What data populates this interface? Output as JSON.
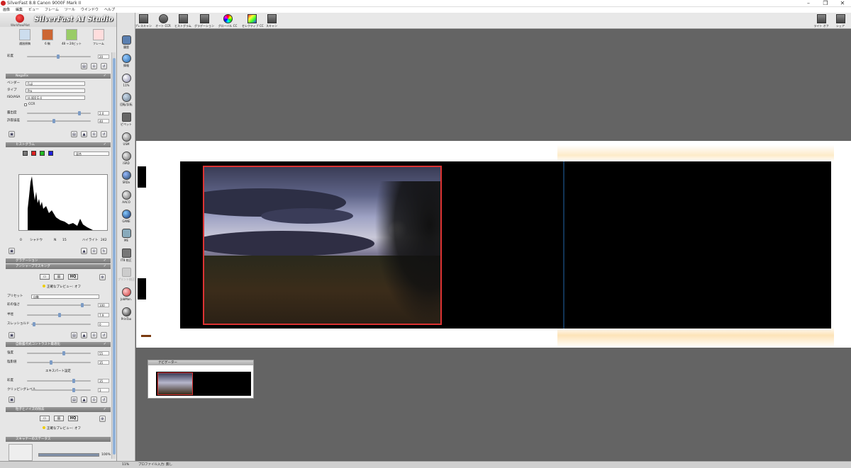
{
  "window": {
    "title": "SilverFast 8.8 Canon 9000F Mark II"
  },
  "menu": [
    "画像",
    "編集",
    "ビュー",
    "フレーム",
    "ツール",
    "ウインドウ",
    "ヘルプ"
  ],
  "logo": {
    "brand": "SilverFast AI Studio",
    "sub": "WorkflowPilot"
  },
  "modes": [
    {
      "label": "通過原稿",
      "icon": "transparency-icon"
    },
    {
      "label": "6 駒",
      "icon": "filmstrip-icon"
    },
    {
      "label": "48 → 24ビット",
      "icon": "bit-depth-icon"
    },
    {
      "label": "フレーム",
      "icon": "frame-icon"
    }
  ],
  "top_row": {
    "label": "彩度",
    "value": "20"
  },
  "negafix": {
    "title": "NegaFix",
    "vendor_label": "ベンダー",
    "vendor": "Fuji",
    "type_label": "タイプ",
    "type": "Pro",
    "iso_label": "ISO/ASA",
    "iso": "H-400 E-4",
    "ccr_label": "CCR",
    "exposure_label": "露出度",
    "exposure": "2.0",
    "tolerance_label": "許容誤差",
    "tolerance": "40"
  },
  "histogram": {
    "title": "ヒストグラム",
    "mode": "混合",
    "shadow_label": "シャドウ",
    "shadow": "0",
    "n_label": "N",
    "n": "15",
    "highlight_label": "ハイライト",
    "highlight": "242"
  },
  "gradation": {
    "title": "グラデーション"
  },
  "usm": {
    "title": "アンシャープマスキング",
    "hq": "HQ",
    "preview_warning": "正確なプレビュー: オフ",
    "preset_label": "プリセット",
    "preset": "自動",
    "strength_label": "彩の強さ",
    "strength": "100",
    "radius_label": "半径",
    "radius": "7.9",
    "threshold_label": "スレッショルド",
    "threshold": "0"
  },
  "auto_contrast": {
    "title": "自動露点式コントラスト最適化",
    "strength_label": "強度",
    "strength": "55",
    "shadow_label": "陰影値",
    "shadow": "35",
    "expert_label": "エキスパート設定",
    "saturation_label": "彩度",
    "saturation": "35",
    "clip_label": "クリッピングレベル",
    "clip": "3"
  },
  "grain": {
    "title": "粒子とノイズの除去",
    "hq": "HQ",
    "preview_warning": "正確なプレビュー: オフ"
  },
  "scanner_status": {
    "title": "スキャナーのステータス",
    "progress_pct": 100,
    "progress_text": "100%"
  },
  "tools": [
    {
      "label": "履歴",
      "icon": "undo-icon"
    },
    {
      "label": "情報",
      "icon": "info-icon"
    },
    {
      "label": "11%",
      "icon": "zoom-icon"
    },
    {
      "label": "回転/反転",
      "icon": "rotate-icon"
    },
    {
      "label": "ピペット",
      "icon": "pipette-icon"
    },
    {
      "label": "USM",
      "icon": "usm-icon"
    },
    {
      "label": "iSRD",
      "icon": "isrd-icon"
    },
    {
      "label": "SRDx",
      "icon": "srdx-icon"
    },
    {
      "label": "AACO",
      "icon": "aaco-icon"
    },
    {
      "label": "GANE",
      "icon": "gane-icon"
    },
    {
      "label": "ME",
      "icon": "multi-exposure-icon"
    },
    {
      "label": "IT8 校正",
      "icon": "it8-icon"
    },
    {
      "label": "プリント校正",
      "icon": "print-calibration-icon"
    },
    {
      "label": "JobMan.",
      "icon": "job-manager-icon"
    },
    {
      "label": "PrinTao",
      "icon": "printao-icon"
    }
  ],
  "toolbar": [
    {
      "label": "プレスキャン",
      "icon": "prescan-icon"
    },
    {
      "label": "オート CCR",
      "icon": "auto-ccr-icon"
    },
    {
      "label": "ヒストグラム",
      "icon": "histogram-icon"
    },
    {
      "label": "グラデーション",
      "icon": "gradation-icon"
    },
    {
      "label": "グローバル CC",
      "icon": "global-cc-icon"
    },
    {
      "label": "セレクティブ CC",
      "icon": "selective-cc-icon"
    },
    {
      "label": "スキャン",
      "icon": "scan-icon"
    }
  ],
  "toolbar_right": [
    {
      "label": "ライト オフ",
      "icon": "light-off-icon"
    },
    {
      "label": "シェア",
      "icon": "share-icon"
    }
  ],
  "navigator": {
    "title": "ナビゲーター"
  },
  "status": {
    "zoom": "11%",
    "profile": "プロファイル入力: 無し"
  },
  "colors": {
    "accent": "#7d9cc5",
    "frame": "#dd3333",
    "workspace": "#646464"
  }
}
